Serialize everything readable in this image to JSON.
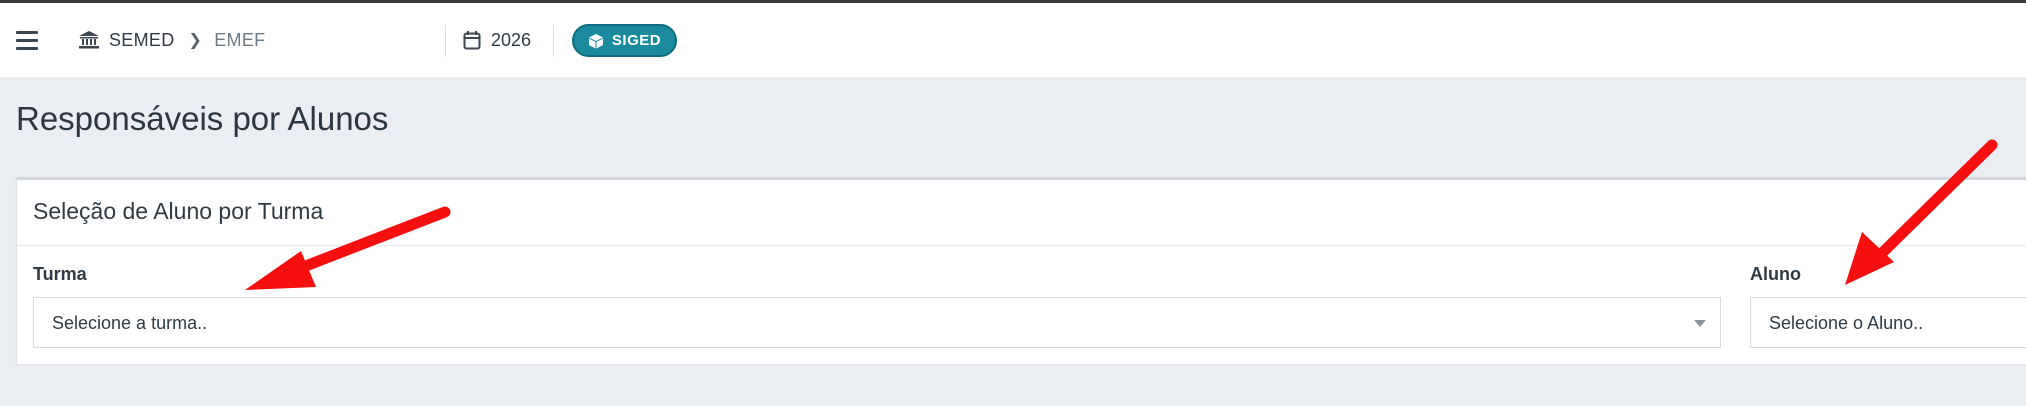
{
  "header": {
    "breadcrumb": {
      "root": "SEMED",
      "child": "EMEF"
    },
    "year": "2026",
    "system_badge": "SIGED"
  },
  "page": {
    "title": "Responsáveis por Alunos"
  },
  "card": {
    "title": "Seleção de Aluno por Turma",
    "fields": {
      "turma": {
        "label": "Turma",
        "placeholder": "Selecione a turma.."
      },
      "aluno": {
        "label": "Aluno",
        "placeholder": "Selecione o Aluno.."
      }
    }
  },
  "colors": {
    "accent": "#1a8a9f",
    "annotation_arrow": "#f50f0f",
    "background": "#eaedf1"
  },
  "icons": [
    "menu-icon",
    "institution-icon",
    "chevron-right-icon",
    "calendar-icon",
    "cube-icon",
    "dropdown-caret-icon"
  ]
}
